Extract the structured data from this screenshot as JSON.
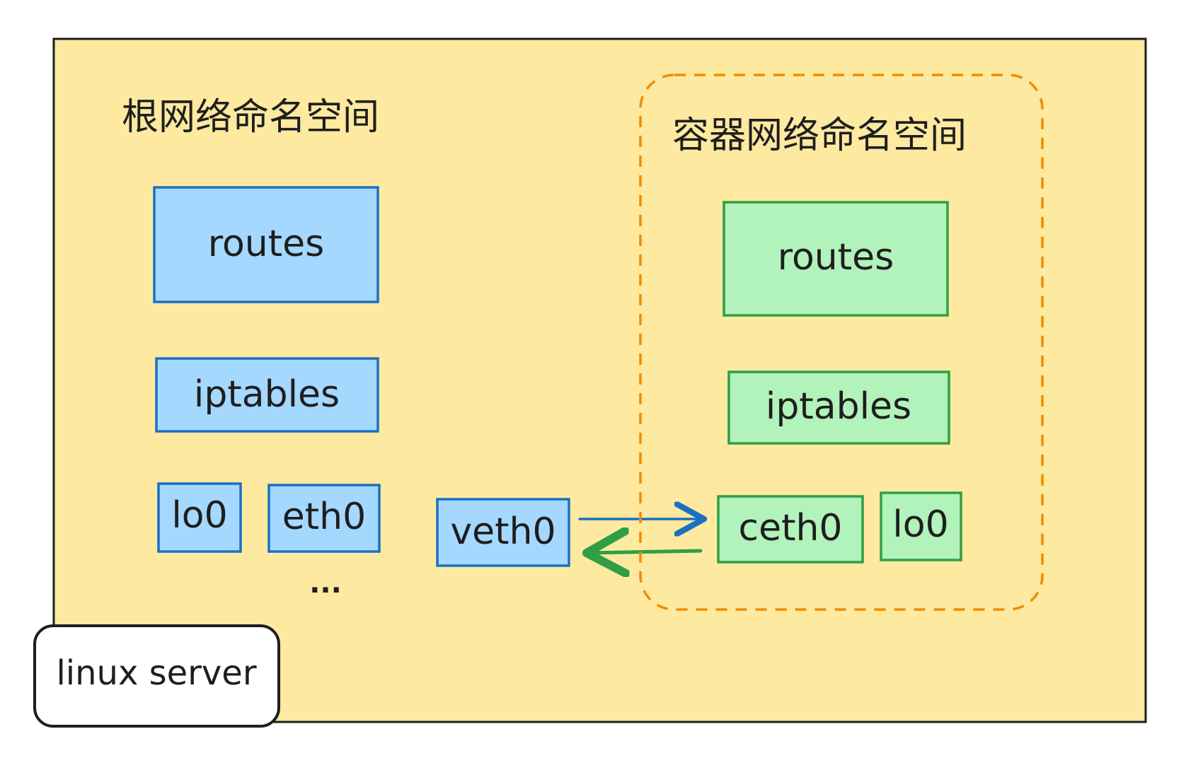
{
  "diagram": {
    "root_namespace": {
      "title": "根网络命名空间",
      "routes": "routes",
      "iptables": "iptables",
      "lo": "lo0",
      "eth": "eth0",
      "more": "..."
    },
    "veth": "veth0",
    "container_namespace": {
      "title": "容器网络命名空间",
      "routes": "routes",
      "iptables": "iptables",
      "ceth": "ceth0",
      "lo": "lo0"
    },
    "server_label": "linux server"
  },
  "colors": {
    "server_bg": "#fde9a0",
    "root_fill": "#a5d8ff",
    "root_stroke": "#1971c2",
    "container_fill": "#b2f2bb",
    "container_stroke": "#2f9e44",
    "namespace_border": "#f08c00",
    "ink": "#1e1e1e"
  }
}
